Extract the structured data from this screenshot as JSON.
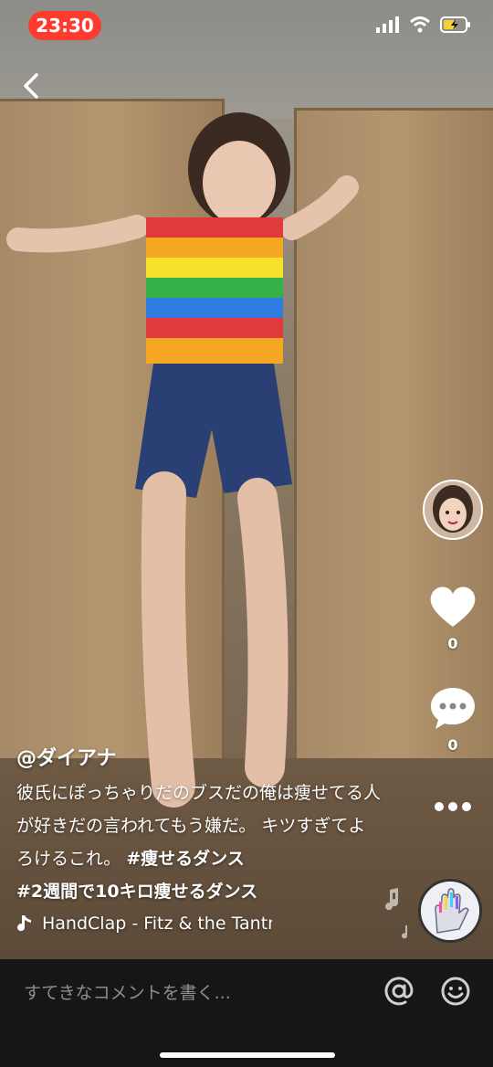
{
  "status_bar": {
    "time": "23:30"
  },
  "creator": {
    "username": "@ダイアナ",
    "likes": "0",
    "comments": "0"
  },
  "caption": {
    "text": "彼氏にぽっちゃりだのブスだの俺は痩せてる人が好きだの言われてもう嫌だ。 キツすぎてよろけるこれ。 ",
    "hashtag1": "#痩せるダンス",
    "hashtag2": "#2週間で10キロ痩せるダンス"
  },
  "music": {
    "title": "HandClap - Fitz & the Tantr"
  },
  "comment_bar": {
    "placeholder": "すてきなコメントを書く..."
  },
  "icons": [
    "back-icon",
    "signal-icon",
    "wifi-icon",
    "battery-icon",
    "heart-icon",
    "comment-icon",
    "more-icon",
    "music-note-icon",
    "at-icon",
    "emoji-icon"
  ]
}
